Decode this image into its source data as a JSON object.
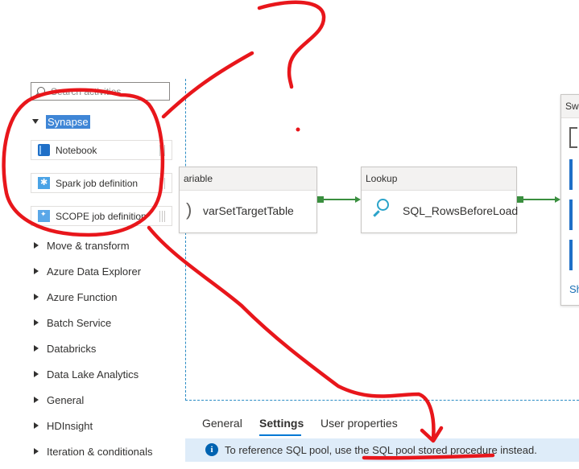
{
  "search": {
    "placeholder": "Search activities"
  },
  "synapse": {
    "label": "Synapse",
    "items": [
      {
        "label": "Notebook",
        "icon": "notebook-icon"
      },
      {
        "label": "Spark job definition",
        "icon": "spark-icon"
      },
      {
        "label": "SCOPE job definition",
        "icon": "scope-icon"
      }
    ]
  },
  "categories": [
    "Move & transform",
    "Azure Data Explorer",
    "Azure Function",
    "Batch Service",
    "Databricks",
    "Data Lake Analytics",
    "General",
    "HDInsight",
    "Iteration & conditionals"
  ],
  "canvas": {
    "set_variable": {
      "header": "ariable",
      "name": "varSetTargetTable"
    },
    "lookup": {
      "header": "Lookup",
      "name": "SQL_RowsBeforeLoad"
    },
    "switch": {
      "header": "Swi",
      "link": "Sh"
    },
    "connector_color": "#3a8f3f"
  },
  "bottom_tabs": [
    "General",
    "Settings",
    "User properties"
  ],
  "active_tab": "Settings",
  "info": {
    "text": "To reference SQL pool, use the SQL pool stored procedure instead."
  },
  "accent_color": "#0078d4",
  "annotation_color": "#e8161b"
}
